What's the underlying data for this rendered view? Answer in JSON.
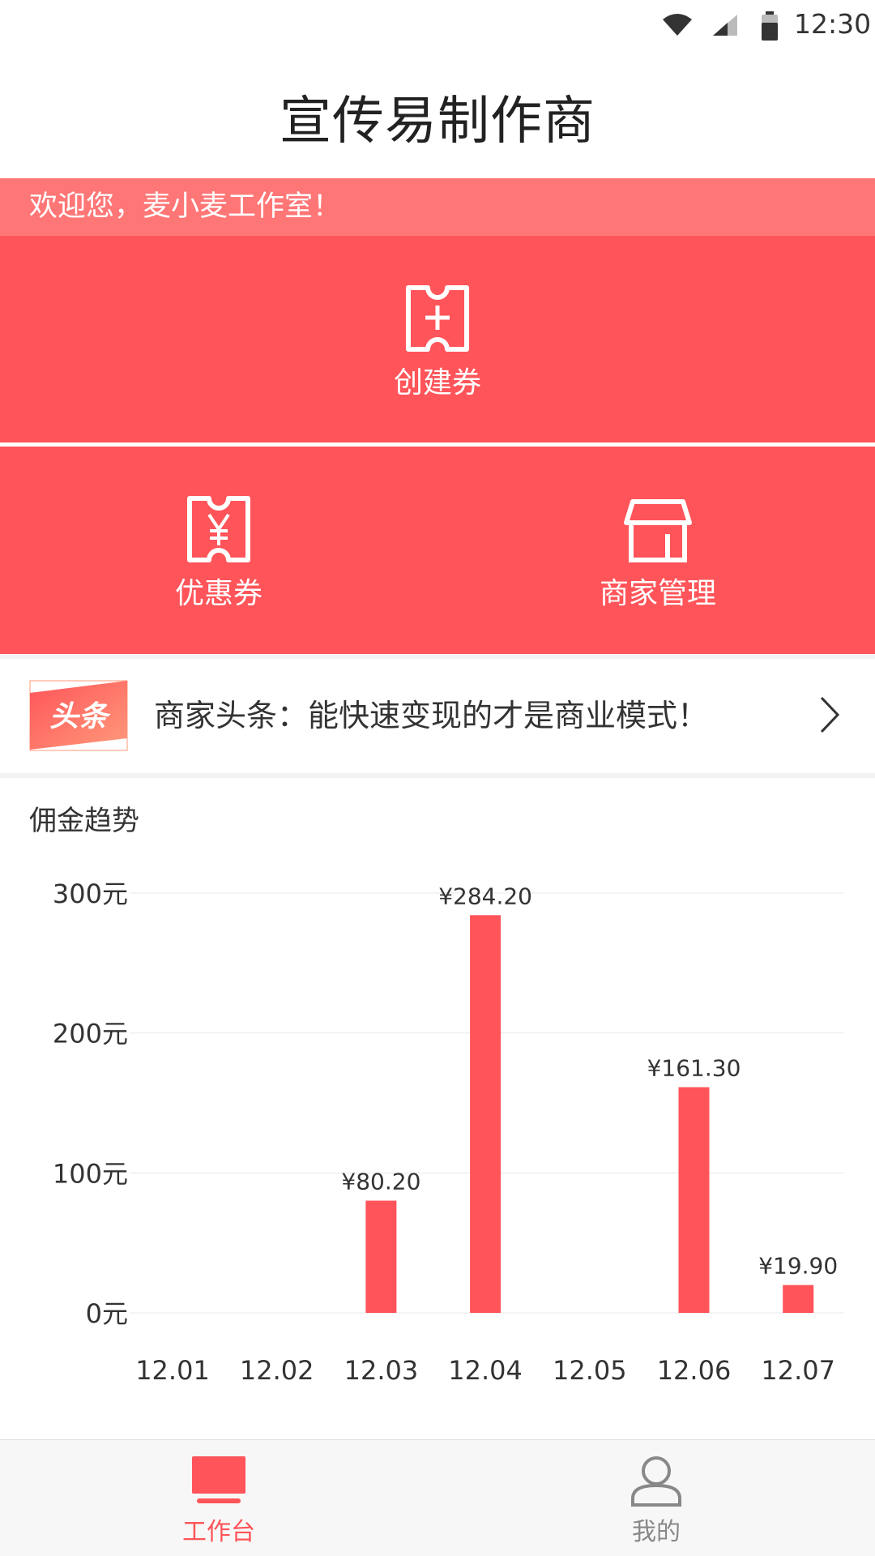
{
  "status_bar": {
    "time": "12:30",
    "icons": [
      "wifi-icon",
      "signal-icon",
      "battery-icon"
    ]
  },
  "header": {
    "title": "宣传易制作商"
  },
  "welcome": {
    "text": "欢迎您，麦小麦工作室！"
  },
  "actions": {
    "create": {
      "label": "创建券",
      "icon": "ticket-plus-icon"
    },
    "coupon": {
      "label": "优惠券",
      "icon": "ticket-yen-icon"
    },
    "merchant": {
      "label": "商家管理",
      "icon": "store-icon"
    }
  },
  "news": {
    "badge": "头条",
    "text": "商家头条：能快速变现的才是商业模式！"
  },
  "chart": {
    "title": "佣金趋势"
  },
  "chart_data": {
    "type": "bar",
    "categories": [
      "12.01",
      "12.02",
      "12.03",
      "12.04",
      "12.05",
      "12.06",
      "12.07"
    ],
    "values": [
      0,
      0,
      80.2,
      284.2,
      0,
      161.3,
      19.9
    ],
    "data_labels": [
      "",
      "",
      "¥80.20",
      "¥284.20",
      "",
      "¥161.30",
      "¥19.90"
    ],
    "y_ticks": [
      "0元",
      "100元",
      "200元",
      "300元"
    ],
    "ylim": [
      0,
      300
    ],
    "grid": true,
    "bar_color": "#ff5459"
  },
  "nav": {
    "work": {
      "label": "工作台",
      "icon": "monitor-icon",
      "active": true
    },
    "mine": {
      "label": "我的",
      "icon": "user-icon",
      "active": false
    }
  },
  "colors": {
    "accent": "#ff5459",
    "banner": "#ff7676"
  }
}
